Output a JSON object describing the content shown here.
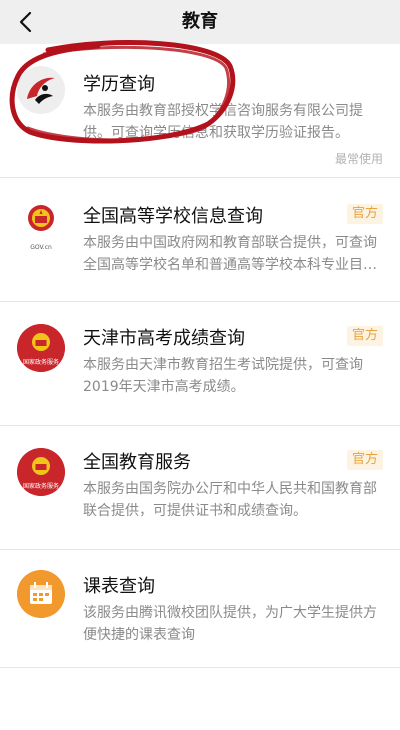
{
  "nav": {
    "title": "教育"
  },
  "items": [
    {
      "name": "学历查询",
      "desc": "本服务由教育部授权学信咨询服务有限公司提供。可查询学历信息和获取学历验证报告。",
      "tag": "最常使用",
      "icon": "xuexin-logo"
    },
    {
      "name": "全国高等学校信息查询",
      "desc": "本服务由中国政府网和教育部联合提供，可查询全国高等学校名单和普通高等学校本科专业目录。",
      "badge": "官方",
      "icon": "gov-cn-emblem",
      "icon_caption": "GOV.cn"
    },
    {
      "name": "天津市高考成绩查询",
      "desc": "本服务由天津市教育招生考试院提供，可查询2019年天津市高考成绩。",
      "badge": "官方",
      "icon": "gov-service-emblem",
      "icon_caption": "国家政务服务"
    },
    {
      "name": "全国教育服务",
      "desc": "本服务由国务院办公厅和中华人民共和国教育部联合提供，可提供证书和成绩查询。",
      "badge": "官方",
      "icon": "gov-service-emblem",
      "icon_caption": "国家政务服务"
    },
    {
      "name": "课表查询",
      "desc": "该服务由腾讯微校团队提供，为广大学生提供方便快捷的课表查询",
      "icon": "calendar-icon"
    }
  ],
  "colors": {
    "badge_text": "#e8a33c",
    "badge_bg": "#fdf3e3",
    "emblem_red": "#c8262b",
    "calendar_orange": "#f2992e",
    "annotation": "#b3121c"
  }
}
